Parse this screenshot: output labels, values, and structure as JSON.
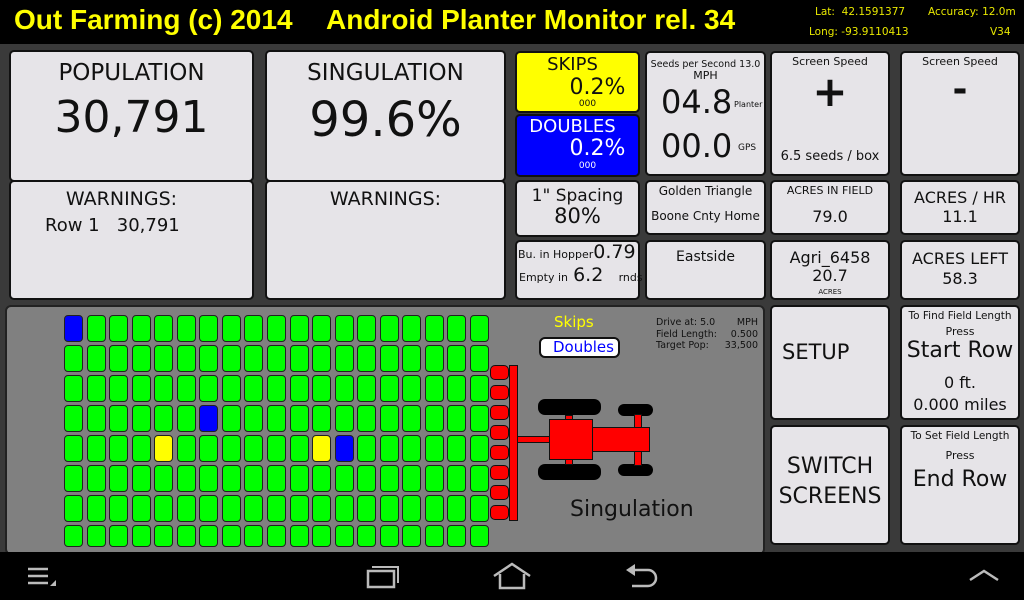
{
  "header": {
    "brand": "Out Farming (c) 2014",
    "title": "Android Planter Monitor rel. 34",
    "lat_label": "Lat:",
    "lat": "42.1591377",
    "long_label": "Long:",
    "long": "-93.9110413",
    "accuracy_label": "Accuracy:",
    "accuracy": "12.0m",
    "version": "V34"
  },
  "population": {
    "label": "POPULATION",
    "value": "30,791",
    "warnings_label": "WARNINGS:",
    "warning_row": "Row 1",
    "warning_value": "30,791"
  },
  "singulation": {
    "label": "SINGULATION",
    "value": "99.6%",
    "warnings_label": "WARNINGS:"
  },
  "skips": {
    "label": "SKIPS",
    "value": "0.2%",
    "count": "000",
    "color": "#ffff00"
  },
  "doubles": {
    "label": "DOUBLES",
    "value": "0.2%",
    "count": "000",
    "color": "#0000ff"
  },
  "spacing": {
    "label": "1\" Spacing",
    "value": "80%"
  },
  "hopper": {
    "bu_label": "Bu. in Hopper",
    "bu_value": "0.79",
    "empty_label": "Empty in",
    "empty_value": "6.2",
    "empty_unit": "rnds"
  },
  "speed": {
    "seeds_label": "Seeds per Second 13.0",
    "unit": "MPH",
    "planter_value": "04.8",
    "planter_label": "Planter",
    "gps_value": "00.0",
    "gps_label": "GPS"
  },
  "farm": {
    "name": "Golden Triangle",
    "location": "Boone Cnty Home"
  },
  "field": {
    "name": "Eastside"
  },
  "screen_speed_plus": {
    "label": "Screen Speed",
    "symbol": "+",
    "info": "6.5 seeds / box"
  },
  "screen_speed_minus": {
    "label": "Screen Speed",
    "symbol": "-"
  },
  "acres_in_field": {
    "label": "ACRES IN FIELD",
    "value": "79.0"
  },
  "acres_hr": {
    "label": "ACRES / HR",
    "value": "11.1"
  },
  "variety": {
    "name": "Agri_6458",
    "value": "20.7",
    "unit": "ACRES"
  },
  "acres_left": {
    "label": "ACRES LEFT",
    "value": "58.3"
  },
  "map": {
    "legend_skips": "Skips",
    "legend_doubles": "Doubles",
    "drive_label": "Drive at: 5.0",
    "drive_unit": "MPH",
    "field_length_label": "Field Length:",
    "field_length": "0.500",
    "target_pop_label": "Target Pop:",
    "target_pop": "33,500",
    "mode": "Singulation",
    "rows": 19,
    "lines": 8,
    "doubles_cells": [
      [
        0,
        0
      ],
      [
        3,
        6
      ],
      [
        4,
        12
      ]
    ],
    "skips_cells": [
      [
        4,
        4
      ],
      [
        4,
        11
      ]
    ],
    "row_units": 8,
    "colors": {
      "ok": "#00ff00",
      "skip": "#ffff00",
      "double": "#0000ff",
      "implement": "#ff0000"
    }
  },
  "buttons": {
    "setup": "SETUP",
    "switch1": "SWITCH",
    "switch2": "SCREENS",
    "start_hint": "To Find Field Length",
    "start_press": "Press",
    "start_label": "Start Row",
    "start_ft": "0 ft.",
    "start_miles": "0.000 miles",
    "end_hint": "To Set Field Length",
    "end_press": "Press",
    "end_label": "End Row"
  },
  "navbar": {
    "icons": [
      "menu-icon",
      "recent-apps-icon",
      "home-icon",
      "back-icon",
      "chevron-up-icon"
    ]
  }
}
